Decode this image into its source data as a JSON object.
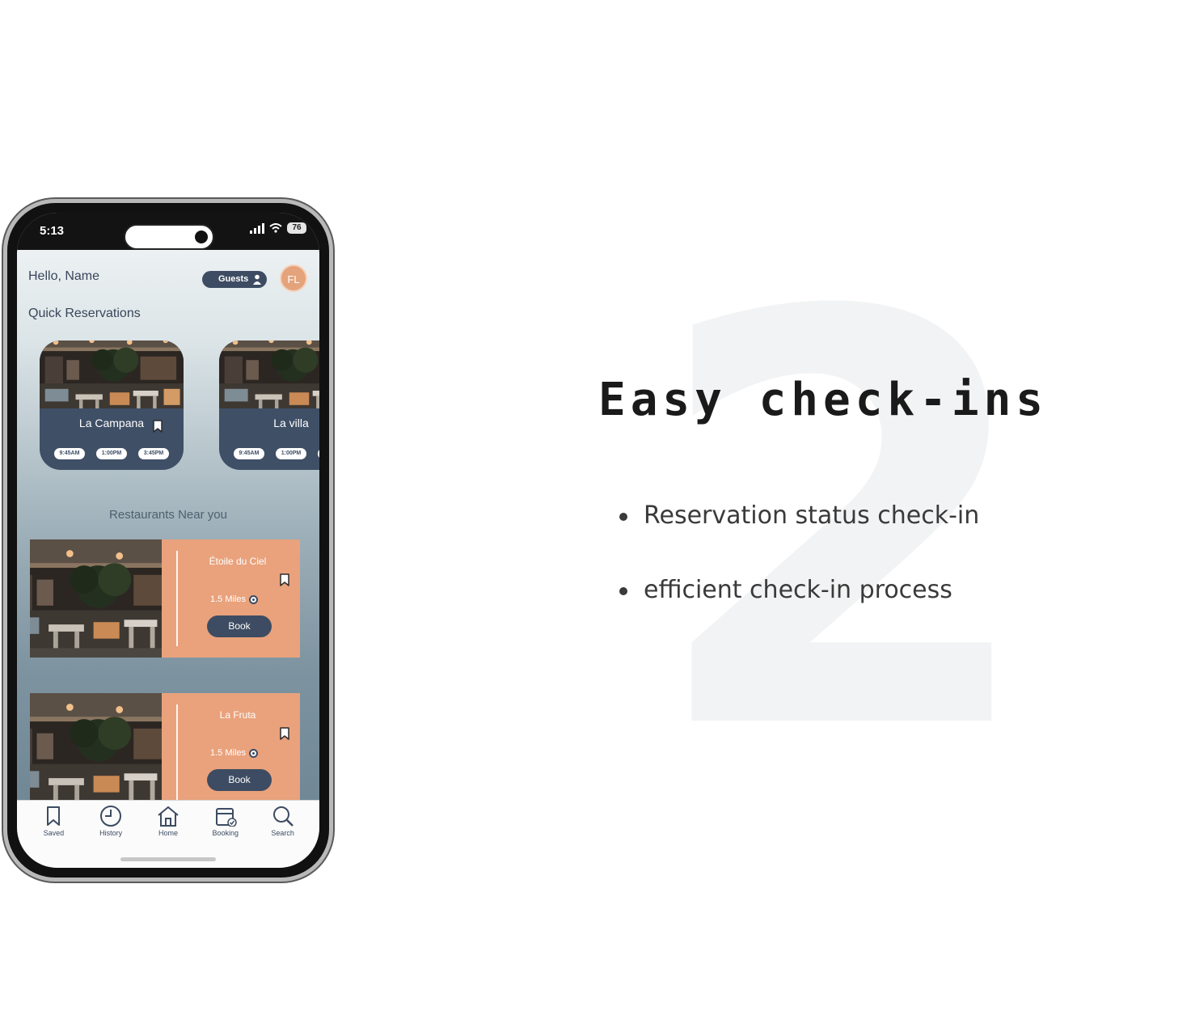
{
  "slide": {
    "number": "2",
    "title": "Easy check-ins",
    "bullets": [
      "Reservation status check-in",
      "efficient check-in process"
    ]
  },
  "status_bar": {
    "time": "5:13",
    "battery": "76"
  },
  "header": {
    "greeting": "Hello, Name",
    "guests_label": "Guests",
    "avatar_initials": "FL"
  },
  "quick_reservations": {
    "title": "Quick Reservations",
    "cards": [
      {
        "name": "La Campana",
        "times": [
          "9:45AM",
          "1:00PM",
          "3:45PM"
        ]
      },
      {
        "name": "La villa",
        "times": [
          "9:45AM",
          "1:00PM",
          ""
        ]
      }
    ]
  },
  "nearby": {
    "title": "Restaurants Near you",
    "restaurants": [
      {
        "name": "Étoile du Ciel",
        "distance": "1.5 Miles",
        "book_label": "Book"
      },
      {
        "name": "La Fruta",
        "distance": "1.5 Miles",
        "book_label": "Book"
      }
    ]
  },
  "tabbar": {
    "tabs": [
      {
        "label": "Saved",
        "icon": "bookmark-icon"
      },
      {
        "label": "History",
        "icon": "clock-icon"
      },
      {
        "label": "Home",
        "icon": "home-icon"
      },
      {
        "label": "Booking",
        "icon": "calendar-check-icon"
      },
      {
        "label": "Search",
        "icon": "search-icon"
      }
    ]
  },
  "colors": {
    "navy": "#3d4c62",
    "peach": "#e9a27c",
    "background": "#ffffff",
    "number_watermark": "#f2f3f4"
  }
}
